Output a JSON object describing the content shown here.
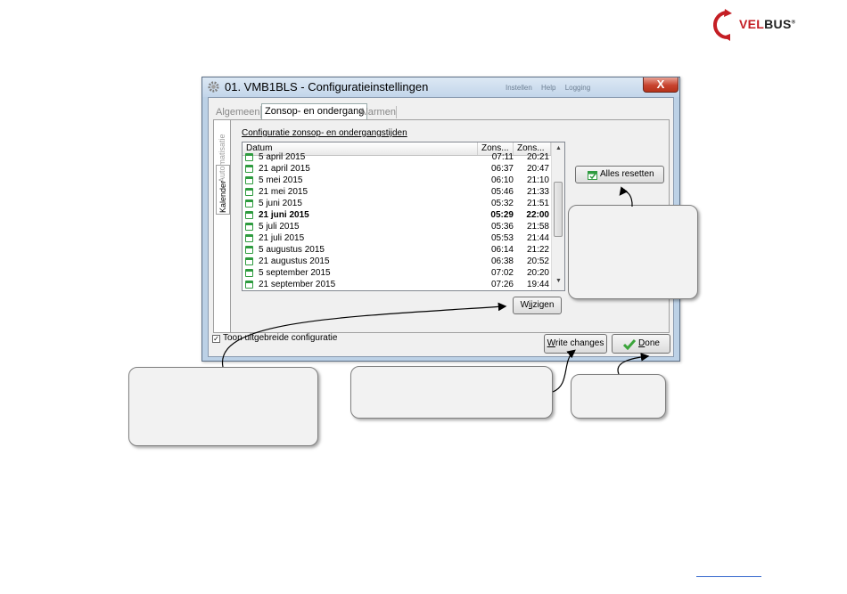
{
  "window": {
    "title": "01. VMB1BLS - Configuratieinstellingen",
    "ghost_tabs": "Instellen Help Logging",
    "close_label": "X"
  },
  "tabs": [
    {
      "label": "Algemeen",
      "active": false
    },
    {
      "label": "Zonsop- en ondergang",
      "active": true
    },
    {
      "label": "Alarmen",
      "active": false
    }
  ],
  "vertical_tabs": [
    {
      "label": "Automatisatie",
      "active": false
    },
    {
      "label": "Kalender",
      "active": true
    }
  ],
  "section_title": "Configuratie zonsop- en ondergangstijden",
  "list": {
    "columns": [
      "Datum",
      "Zons...",
      "Zons..."
    ],
    "rows": [
      {
        "date": "5 april 2015",
        "rise": "07:11",
        "set": "20:21",
        "bold": false
      },
      {
        "date": "21 april 2015",
        "rise": "06:37",
        "set": "20:47",
        "bold": false
      },
      {
        "date": "5 mei 2015",
        "rise": "06:10",
        "set": "21:10",
        "bold": false
      },
      {
        "date": "21 mei 2015",
        "rise": "05:46",
        "set": "21:33",
        "bold": false
      },
      {
        "date": "5 juni 2015",
        "rise": "05:32",
        "set": "21:51",
        "bold": false
      },
      {
        "date": "21 juni 2015",
        "rise": "05:29",
        "set": "22:00",
        "bold": true
      },
      {
        "date": "5 juli 2015",
        "rise": "05:36",
        "set": "21:58",
        "bold": false
      },
      {
        "date": "21 juli 2015",
        "rise": "05:53",
        "set": "21:44",
        "bold": false
      },
      {
        "date": "5 augustus 2015",
        "rise": "06:14",
        "set": "21:22",
        "bold": false
      },
      {
        "date": "21 augustus 2015",
        "rise": "06:38",
        "set": "20:52",
        "bold": false
      },
      {
        "date": "5 september 2015",
        "rise": "07:02",
        "set": "20:20",
        "bold": false
      },
      {
        "date": "21 september 2015",
        "rise": "07:26",
        "set": "19:44",
        "bold": false
      }
    ]
  },
  "buttons": {
    "reset_label": "Alles resetten",
    "edit_prefix": "W",
    "edit_underline": "i",
    "edit_rest": "jzigen",
    "write_prefix": "",
    "write_underline": "W",
    "write_rest": "rite changes",
    "done_underline": "D",
    "done_rest": "one"
  },
  "checkbox": {
    "label": "Toon uitgebreide configuratie",
    "checked_mark": "✓"
  },
  "logo": {
    "part1": "VEL",
    "part2": "BUS",
    "mark": "®"
  },
  "colors": {
    "window_frame": "#bcd1e6",
    "close_button": "#c8432f",
    "calendar_icon": "#2e9b3f",
    "brand_red": "#c41e24"
  }
}
